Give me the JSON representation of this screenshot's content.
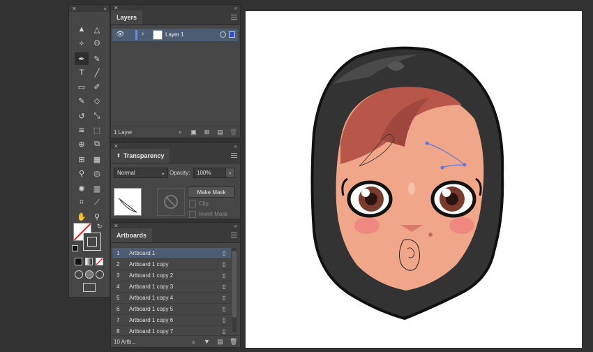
{
  "colors": {
    "bg": "#323232",
    "panel": "#464646",
    "selection": "#4b5c73",
    "layer_accent": "#6b8ed6"
  },
  "tools_panel": {
    "collapse": "«",
    "close": "✕"
  },
  "layers": {
    "tab": "Layers",
    "layer_name": "Layer 1",
    "count": "1 Layer"
  },
  "transparency": {
    "tab": "Transparency",
    "blend_mode": "Normal",
    "opacity_label": "Opacity:",
    "opacity_value": "100%",
    "make_mask": "Make Mask",
    "clip": "Clip",
    "invert_mask": "Invert Mask"
  },
  "artboards": {
    "tab": "Artboards",
    "count": "10 Artb...",
    "rows": [
      {
        "num": "1",
        "name": "Artboard 1"
      },
      {
        "num": "2",
        "name": "Artboard 1 copy"
      },
      {
        "num": "3",
        "name": "Artboard 1 copy 2"
      },
      {
        "num": "4",
        "name": "Artboard 1 copy 3"
      },
      {
        "num": "5",
        "name": "Artboard 1 copy 4"
      },
      {
        "num": "6",
        "name": "Artboard 1 copy 5"
      },
      {
        "num": "7",
        "name": "Artboard 1 copy 6"
      },
      {
        "num": "8",
        "name": "Artboard 1 copy 7"
      }
    ]
  },
  "icons": [
    "selection-tool",
    "direct-selection-tool",
    "magic-wand",
    "lasso",
    "pen",
    "curvature",
    "type",
    "line",
    "rectangle",
    "paintbrush",
    "shaper",
    "eraser",
    "rotate",
    "scale",
    "warp",
    "free-transform",
    "shape-builder",
    "perspective",
    "mesh",
    "gradient",
    "eyedropper",
    "blend",
    "symbol-sprayer",
    "column-graph",
    "artboard",
    "slice",
    "hand",
    "zoom"
  ]
}
